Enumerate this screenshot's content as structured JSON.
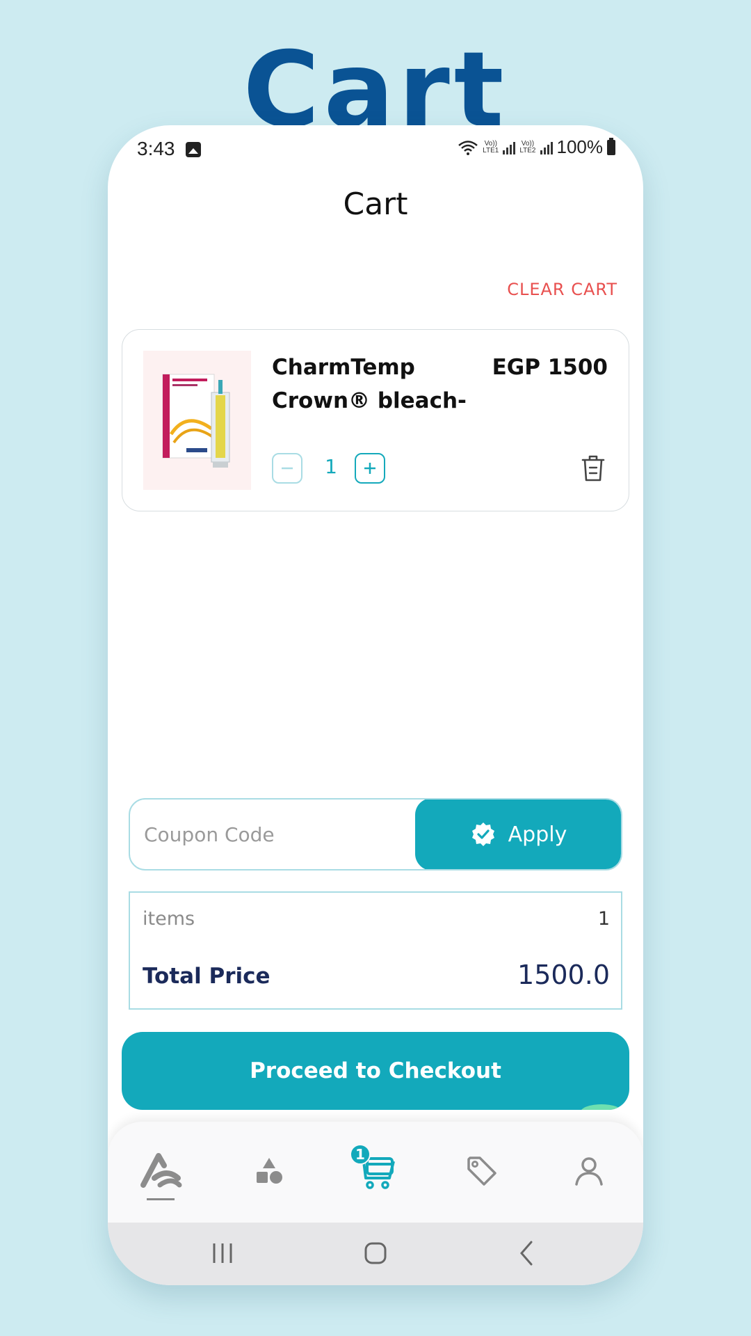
{
  "hero": {
    "title": "Cart"
  },
  "status_bar": {
    "time": "3:43",
    "lte1": "Vo))\nLTE1",
    "lte2": "Vo))\nLTE2",
    "battery": "100%"
  },
  "header": {
    "title": "Cart"
  },
  "actions": {
    "clear_cart": "CLEAR CART"
  },
  "cart": {
    "items": [
      {
        "title": "CharmTemp Crown® bleach-",
        "price": "EGP 1500",
        "quantity": "1"
      }
    ]
  },
  "coupon": {
    "placeholder": "Coupon Code",
    "value": "",
    "apply_label": "Apply"
  },
  "summary": {
    "items_label": "items",
    "items_value": "1",
    "total_label": "Total Price",
    "total_value": "1500.0"
  },
  "checkout": {
    "label": "Proceed to Checkout"
  },
  "bottom_nav": {
    "items": [
      {
        "icon": "home-logo-icon",
        "active": true
      },
      {
        "icon": "categories-icon",
        "active": false
      },
      {
        "icon": "cart-icon",
        "active": true,
        "badge": "1"
      },
      {
        "icon": "tag-icon",
        "active": false
      },
      {
        "icon": "profile-icon",
        "active": false
      }
    ]
  },
  "colors": {
    "accent": "#13a9bb",
    "danger": "#e8504f",
    "heading": "#0a5394",
    "summary_text": "#1b2a5a",
    "background": "#cdebf1"
  }
}
